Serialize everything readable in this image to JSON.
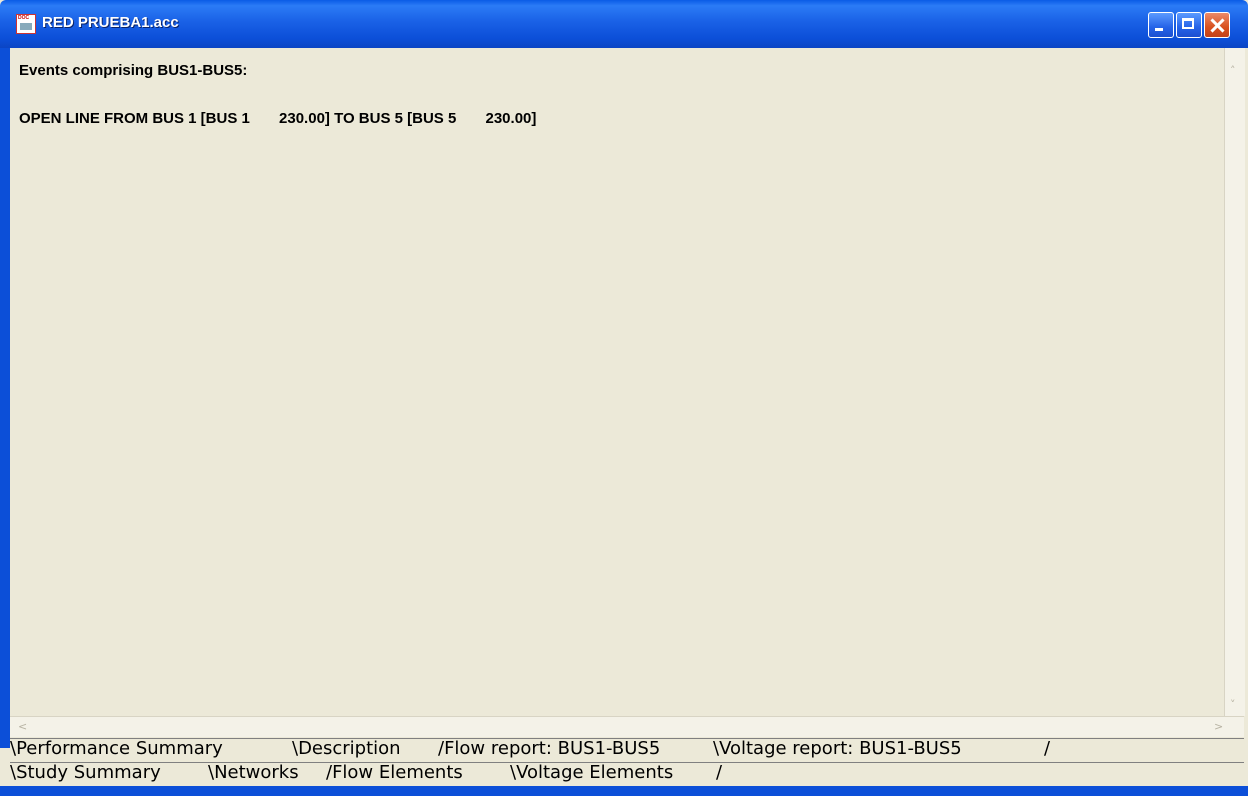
{
  "window": {
    "title": "RED PRUEBA1.acc"
  },
  "content": {
    "lines": [
      "Events comprising BUS1-BUS5:",
      "OPEN LINE FROM BUS 1 [BUS 1       230.00] TO BUS 5 [BUS 5       230.00]"
    ]
  },
  "tabs_row1": [
    "\\Performance Summary",
    "\\Description",
    "/Flow report: BUS1-BUS5",
    "\\Voltage report: BUS1-BUS5",
    "/"
  ],
  "tabs_row2": [
    "\\Study Summary",
    "\\Networks",
    "/Flow Elements",
    "\\Voltage Elements",
    "/"
  ],
  "scroll": {
    "up": "˄",
    "down": "˅",
    "left": "<",
    "right": ">"
  },
  "colors": {
    "titlebar": "#0C4FD8",
    "background": "#ECE9D8"
  }
}
